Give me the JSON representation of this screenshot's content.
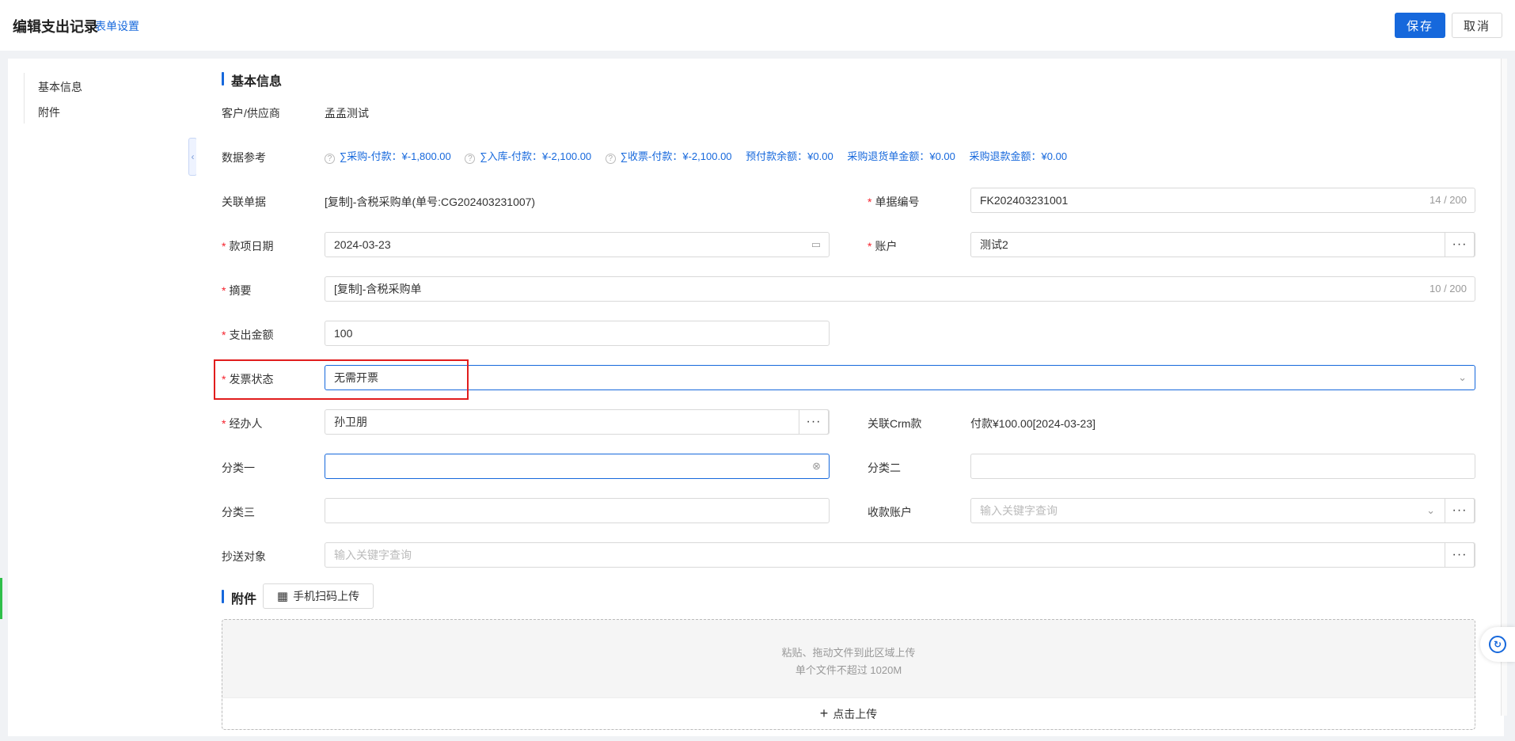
{
  "header": {
    "title": "编辑支出记录",
    "form_settings": "表单设置",
    "save": "保存",
    "cancel": "取消"
  },
  "sidebar": {
    "items": [
      {
        "label": "基本信息"
      },
      {
        "label": "附件"
      }
    ],
    "collapse_icon": "collapse-left-icon"
  },
  "basic": {
    "section_title": "基本信息",
    "customer": {
      "label": "客户/供应商",
      "value": "孟孟测试"
    },
    "data_ref": {
      "label": "数据参考",
      "items": [
        "∑采购-付款：¥-1,800.00",
        "∑入库-付款：¥-2,100.00",
        "∑收票-付款：¥-2,100.00",
        "预付款余额：¥0.00",
        "采购退货单金额：¥0.00",
        "采购退款金额：¥0.00"
      ]
    },
    "related_doc": {
      "label": "关联单据",
      "value": "[复制]-含税采购单(单号:CG202403231007)"
    },
    "doc_no": {
      "label": "单据编号",
      "value": "FK202403231001",
      "counter": "14 / 200"
    },
    "date": {
      "label": "款项日期",
      "value": "2024-03-23",
      "icon": "calendar-icon"
    },
    "account": {
      "label": "账户",
      "value": "测试2",
      "more": "···"
    },
    "summary": {
      "label": "摘要",
      "value": "[复制]-含税采购单",
      "counter": "10 / 200"
    },
    "amount": {
      "label": "支出金额",
      "value": "100"
    },
    "invoice_status": {
      "label": "发票状态",
      "value": "无需开票",
      "icon": "chevron-down-icon"
    },
    "handler": {
      "label": "经办人",
      "value": "孙卫朋",
      "more": "···"
    },
    "crm": {
      "label": "关联Crm款",
      "value": "付款¥100.00[2024-03-23]"
    },
    "cat1": {
      "label": "分类一",
      "value": "",
      "icon": "clear-icon"
    },
    "cat2": {
      "label": "分类二",
      "value": ""
    },
    "cat3": {
      "label": "分类三",
      "value": ""
    },
    "receive_account": {
      "label": "收款账户",
      "placeholder": "输入关键字查询",
      "more": "···"
    },
    "cc": {
      "label": "抄送对象",
      "placeholder": "输入关键字查询",
      "more": "···"
    }
  },
  "attachments": {
    "section_title": "附件",
    "qr_upload": "手机扫码上传",
    "drop_hint": "粘贴、拖动文件到此区域上传",
    "size_hint": "单个文件不超过 1020M",
    "click_upload": "点击上传"
  },
  "required_mark": "*",
  "colors": {
    "accent": "#1668dc",
    "required": "#f5222d",
    "highlight": "#e11d1d"
  }
}
